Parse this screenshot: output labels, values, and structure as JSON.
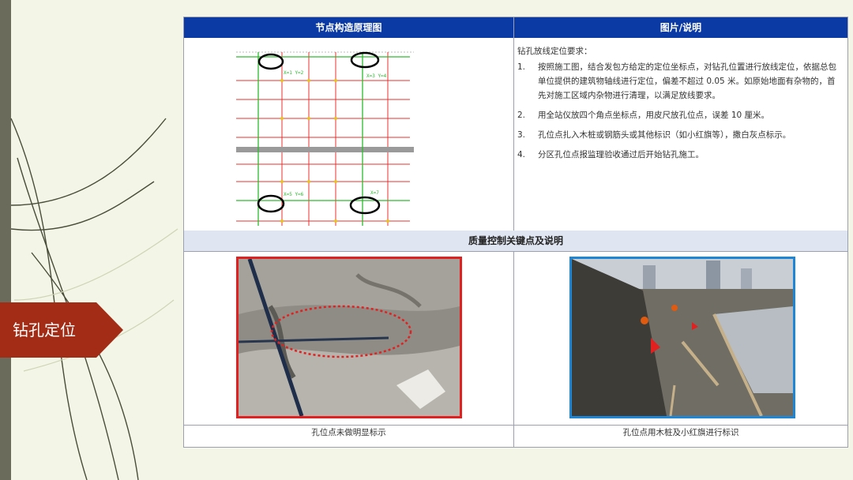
{
  "section_tag": "钻孔定位",
  "table": {
    "header_left": "节点构造原理图",
    "header_right": "图片/说明",
    "description_title": "钻孔放线定位要求：",
    "description_items": [
      {
        "num": "1.",
        "text": "按照施工图，结合发包方给定的定位坐标点，对钻孔位置进行放线定位，依据总包单位提供的建筑物轴线进行定位，偏差不超过 0.05 米。如原始地面有杂物的，首先对施工区域内杂物进行清理，以满足放线要求。"
      },
      {
        "num": "2.",
        "text": "用全站仪放四个角点坐标点，用皮尺放孔位点，误差 10 厘米。"
      },
      {
        "num": "3.",
        "text": "孔位点扎入木桩或钢筋头或其他标识（如小红旗等），撒白灰点标示。"
      },
      {
        "num": "4.",
        "text": "分区孔位点报监理验收通过后开始钻孔施工。"
      }
    ],
    "quality_header": "质量控制关键点及说明",
    "caption_left": "孔位点未做明显标示",
    "caption_right": "孔位点用木桩及小红旗进行标识"
  },
  "colors": {
    "header_blue": "#0c3aa5",
    "tag_red": "#a32c16",
    "photo_left_border": "#e32020",
    "photo_right_border": "#1d86d6"
  }
}
